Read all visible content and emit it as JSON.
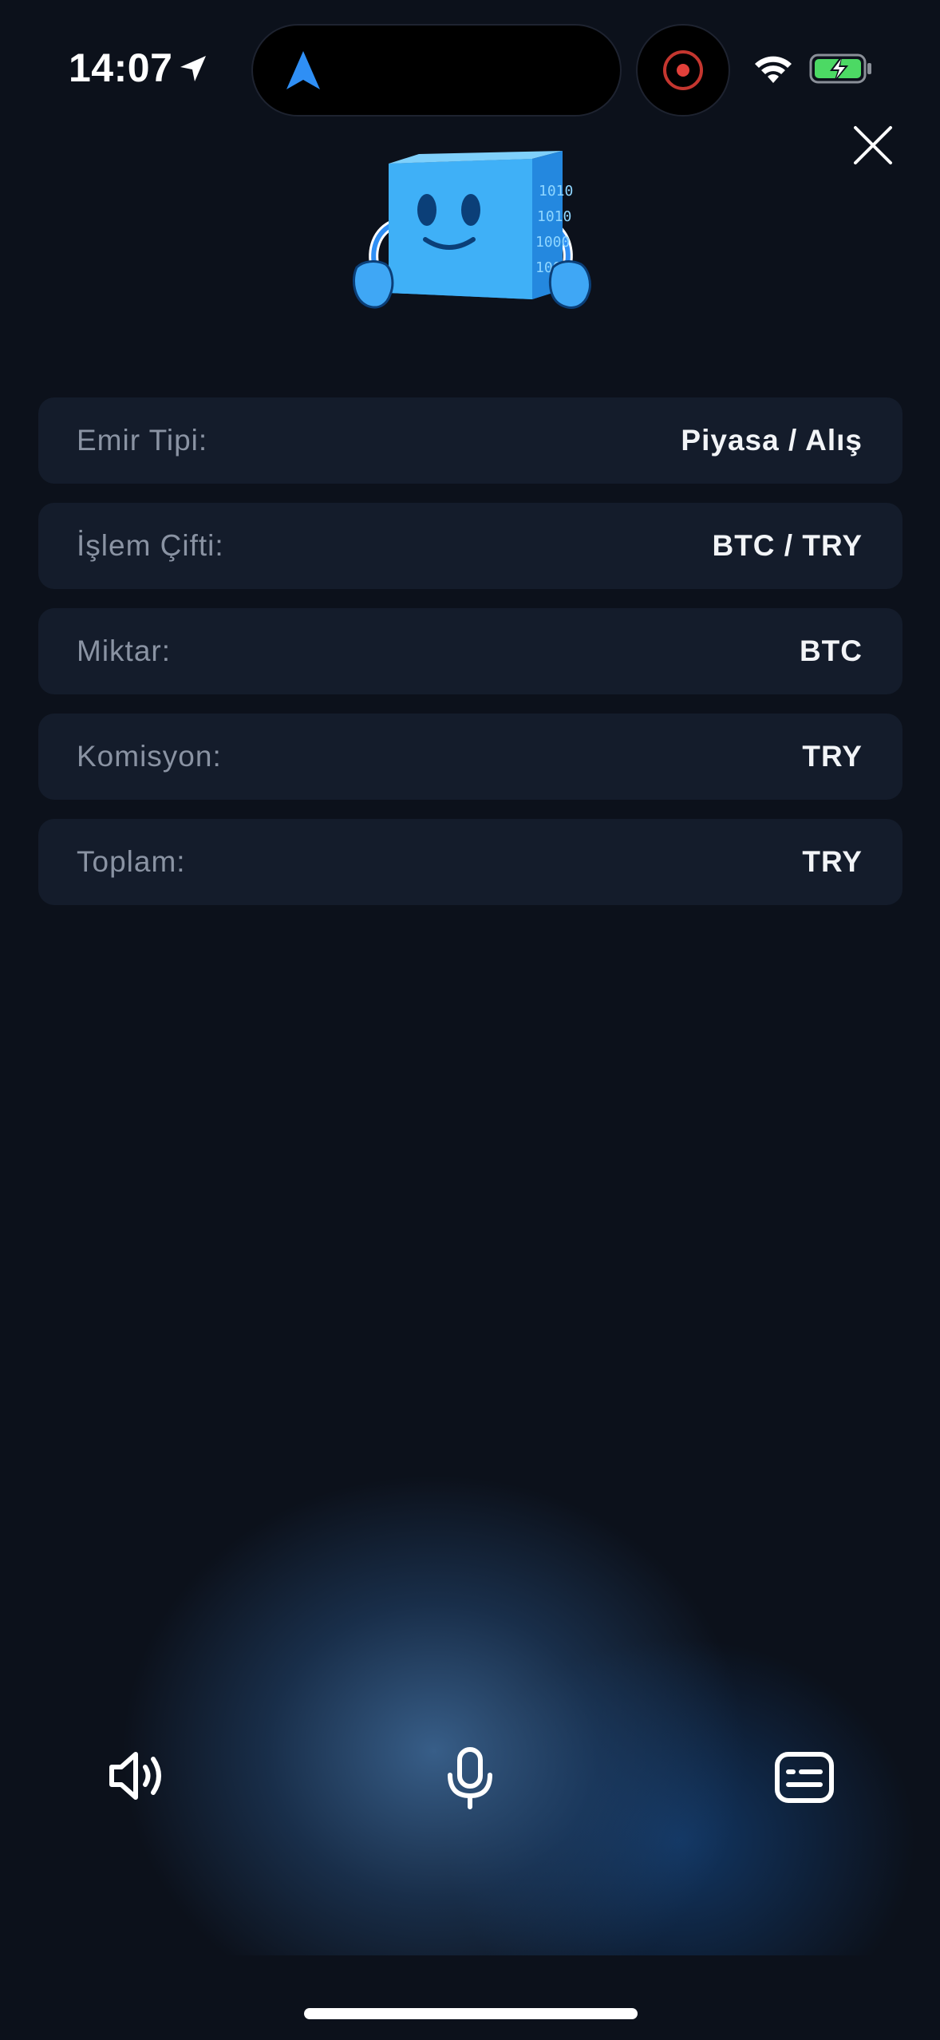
{
  "status_bar": {
    "time": "14:07",
    "icons": [
      "location-arrow-icon",
      "navigation-icon",
      "screen-record-icon",
      "wifi-icon",
      "battery-charging-icon"
    ],
    "battery_color": "#4cd964",
    "record_color": "#e2403a",
    "nav_color": "#2f8ff5"
  },
  "header": {
    "close_icon": "close-icon",
    "mascot": "cube-mascot-illustration"
  },
  "order_details": [
    {
      "label": "Emir Tipi:",
      "value": "Piyasa / Alış"
    },
    {
      "label": "İşlem Çifti:",
      "value": "BTC / TRY"
    },
    {
      "label": "Miktar:",
      "value": "BTC"
    },
    {
      "label": "Komisyon:",
      "value": "TRY"
    },
    {
      "label": "Toplam:",
      "value": "TRY"
    }
  ],
  "controls": {
    "speaker_icon": "speaker-icon",
    "mic_icon": "microphone-icon",
    "subtitles_icon": "subtitles-icon"
  },
  "colors": {
    "background": "#0c111b",
    "row_background": "#141c2b",
    "label": "#8a93a3",
    "value": "#f2f4f7",
    "glow": "#3a628e"
  }
}
